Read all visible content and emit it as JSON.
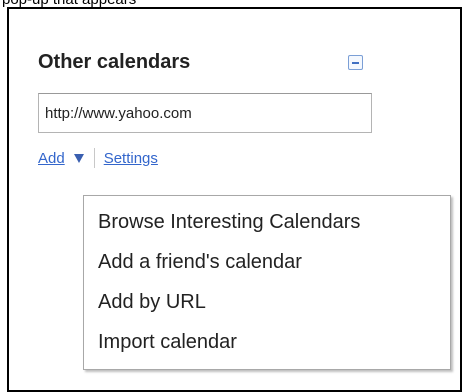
{
  "caption": "pop-up that appears",
  "other_calendars": {
    "title": "Other calendars",
    "collapse_icon": "minus-square-icon",
    "url_input": {
      "value": "http://www.yahoo.com",
      "placeholder": ""
    },
    "add_label": "Add",
    "add_arrow_icon": "triangle-down-icon",
    "settings_label": "Settings"
  },
  "add_menu": {
    "items": [
      {
        "label": "Browse Interesting Calendars"
      },
      {
        "label": "Add a friend's calendar"
      },
      {
        "label": "Add by URL"
      },
      {
        "label": "Import calendar"
      }
    ]
  },
  "colors": {
    "link": "#3366cc",
    "frame_border": "#000000",
    "menu_border": "#a8a8a8"
  }
}
